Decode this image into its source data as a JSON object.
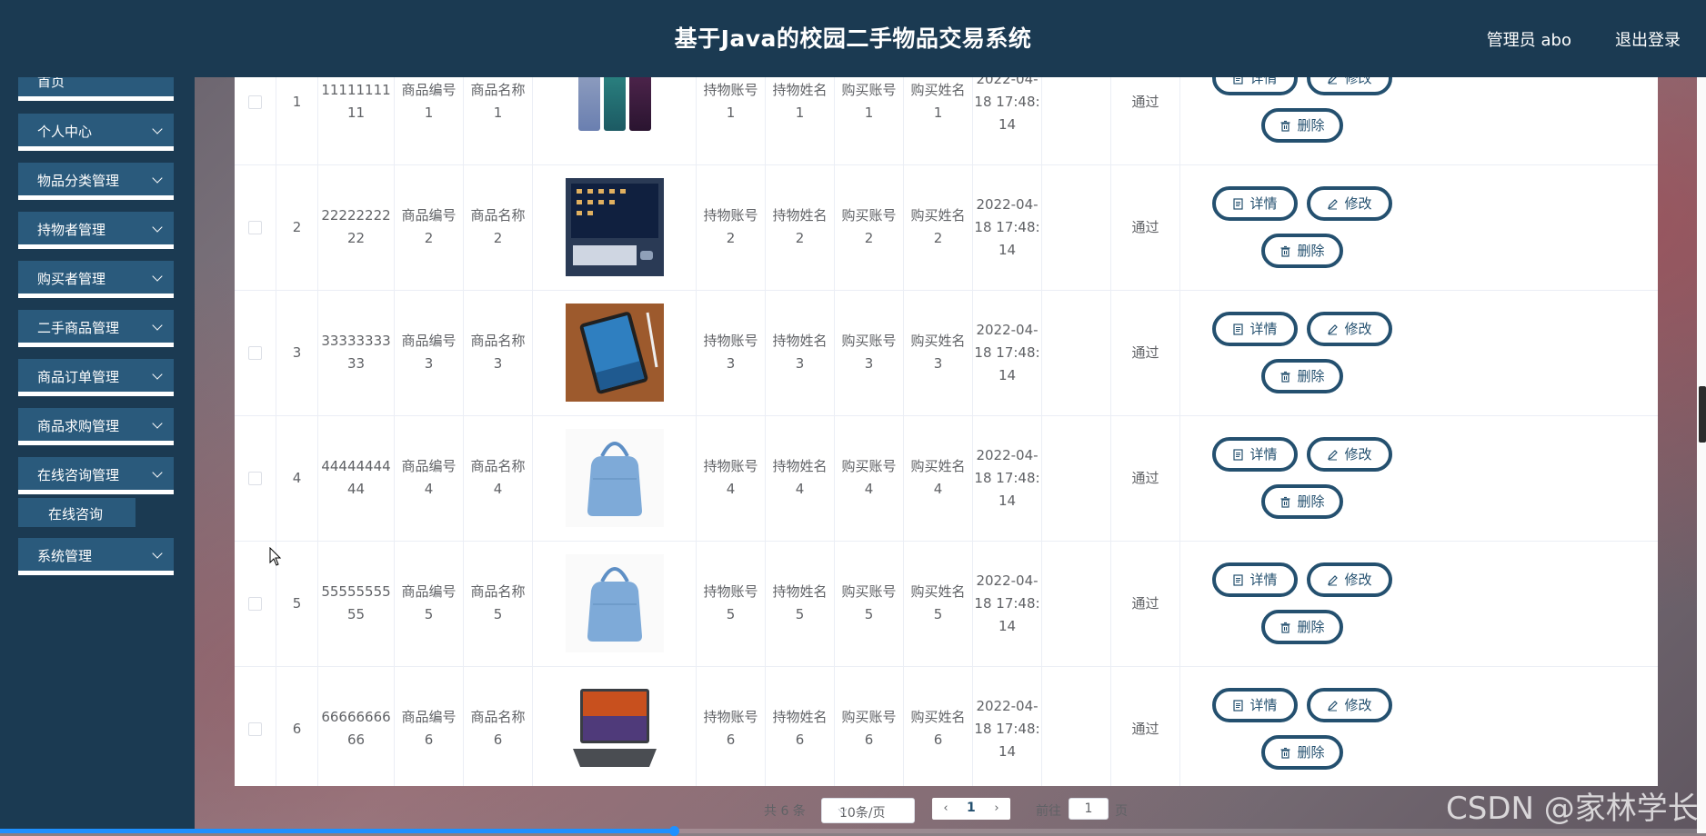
{
  "header": {
    "title": "基于Java的校园二手物品交易系统",
    "user": "管理员 abo",
    "logout": "退出登录"
  },
  "sidebar": {
    "items": [
      {
        "label": "首页"
      },
      {
        "label": "个人中心"
      },
      {
        "label": "物品分类管理"
      },
      {
        "label": "持物者管理"
      },
      {
        "label": "购买者管理"
      },
      {
        "label": "二手商品管理"
      },
      {
        "label": "商品订单管理"
      },
      {
        "label": "商品求购管理"
      },
      {
        "label": "在线咨询管理"
      },
      {
        "label": "系统管理"
      }
    ],
    "sub_item": "在线咨询"
  },
  "table": {
    "rows": [
      {
        "index": "1",
        "order_no_1": "11111111",
        "order_no_2": "11",
        "goods_no_1": "商品编号",
        "goods_no_2": "1",
        "goods_name_1": "商品名称",
        "goods_name_2": "1",
        "image": "phones",
        "holder_acc_1": "持物账号",
        "holder_acc_2": "1",
        "holder_name_1": "持物姓名",
        "holder_name_2": "1",
        "buyer_acc_1": "购买账号",
        "buyer_acc_2": "1",
        "buyer_name_1": "购买姓名",
        "buyer_name_2": "1",
        "time_1": "2022-04-",
        "time_2": "18 17:48:",
        "time_3": "14",
        "status": "通过"
      },
      {
        "index": "2",
        "order_no_1": "22222222",
        "order_no_2": "22",
        "goods_no_1": "商品编号",
        "goods_no_2": "2",
        "goods_name_1": "商品名称",
        "goods_name_2": "2",
        "image": "computer",
        "holder_acc_1": "持物账号",
        "holder_acc_2": "2",
        "holder_name_1": "持物姓名",
        "holder_name_2": "2",
        "buyer_acc_1": "购买账号",
        "buyer_acc_2": "2",
        "buyer_name_1": "购买姓名",
        "buyer_name_2": "2",
        "time_1": "2022-04-",
        "time_2": "18 17:48:",
        "time_3": "14",
        "status": "通过"
      },
      {
        "index": "3",
        "order_no_1": "33333333",
        "order_no_2": "33",
        "goods_no_1": "商品编号",
        "goods_no_2": "3",
        "goods_name_1": "商品名称",
        "goods_name_2": "3",
        "image": "tablet",
        "holder_acc_1": "持物账号",
        "holder_acc_2": "3",
        "holder_name_1": "持物姓名",
        "holder_name_2": "3",
        "buyer_acc_1": "购买账号",
        "buyer_acc_2": "3",
        "buyer_name_1": "购买姓名",
        "buyer_name_2": "3",
        "time_1": "2022-04-",
        "time_2": "18 17:48:",
        "time_3": "14",
        "status": "通过"
      },
      {
        "index": "4",
        "order_no_1": "44444444",
        "order_no_2": "44",
        "goods_no_1": "商品编号",
        "goods_no_2": "4",
        "goods_name_1": "商品名称",
        "goods_name_2": "4",
        "image": "handbag",
        "holder_acc_1": "持物账号",
        "holder_acc_2": "4",
        "holder_name_1": "持物姓名",
        "holder_name_2": "4",
        "buyer_acc_1": "购买账号",
        "buyer_acc_2": "4",
        "buyer_name_1": "购买姓名",
        "buyer_name_2": "4",
        "time_1": "2022-04-",
        "time_2": "18 17:48:",
        "time_3": "14",
        "status": "通过"
      },
      {
        "index": "5",
        "order_no_1": "55555555",
        "order_no_2": "55",
        "goods_no_1": "商品编号",
        "goods_no_2": "5",
        "goods_name_1": "商品名称",
        "goods_name_2": "5",
        "image": "handbag",
        "holder_acc_1": "持物账号",
        "holder_acc_2": "5",
        "holder_name_1": "持物姓名",
        "holder_name_2": "5",
        "buyer_acc_1": "购买账号",
        "buyer_acc_2": "5",
        "buyer_name_1": "购买姓名",
        "buyer_name_2": "5",
        "time_1": "2022-04-",
        "time_2": "18 17:48:",
        "time_3": "14",
        "status": "通过"
      },
      {
        "index": "6",
        "order_no_1": "66666666",
        "order_no_2": "66",
        "goods_no_1": "商品编号",
        "goods_no_2": "6",
        "goods_name_1": "商品名称",
        "goods_name_2": "6",
        "image": "laptop",
        "holder_acc_1": "持物账号",
        "holder_acc_2": "6",
        "holder_name_1": "持物姓名",
        "holder_name_2": "6",
        "buyer_acc_1": "购买账号",
        "buyer_acc_2": "6",
        "buyer_name_1": "购买姓名",
        "buyer_name_2": "6",
        "time_1": "2022-04-",
        "time_2": "18 17:48:",
        "time_3": "14",
        "status": "通过"
      }
    ],
    "actions": {
      "detail": "详情",
      "edit": "修改",
      "delete": "删除"
    }
  },
  "pagination": {
    "total": "共 6 条",
    "page_size": "10条/页",
    "current": "1",
    "goto_label": "前往",
    "goto_value": "1",
    "unit": "页"
  },
  "watermark": "CSDN @家林学长",
  "video_progress": 0.395,
  "colors": {
    "primary": "#1b3a52",
    "menu": "#2a5a7c",
    "button": "#24506f",
    "progress": "#1e90ff"
  }
}
